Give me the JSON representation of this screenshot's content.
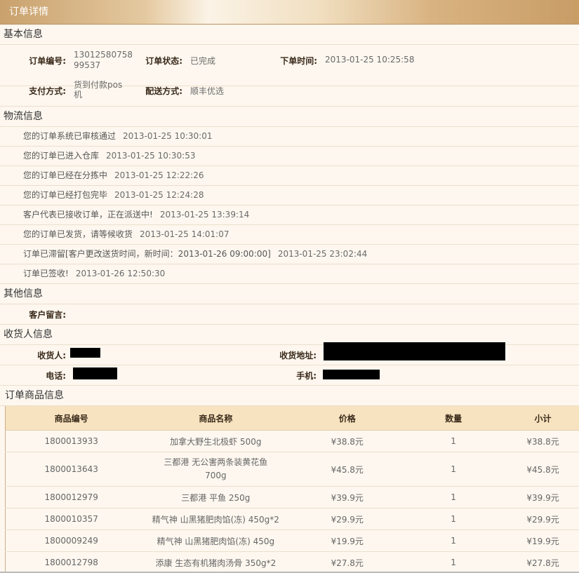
{
  "window": {
    "title": "订单详情"
  },
  "sections": {
    "basic": "基本信息",
    "logistics": "物流信息",
    "other": "其他信息",
    "receiver": "收货人信息",
    "goods": "订单商品信息"
  },
  "basic": {
    "order_no_label": "订单编号:",
    "order_no_line1": "13012580758",
    "order_no_line2": "99537",
    "status_label": "订单状态:",
    "status_value": "已完成",
    "time_label": "下单时间:",
    "time_value": "2013-01-25 10:25:58",
    "pay_label": "支付方式:",
    "pay_line1": "货到付款pos",
    "pay_line2": "机",
    "ship_label": "配送方式:",
    "ship_value": "顺丰优选"
  },
  "logistics": [
    {
      "text": "您的订单系统已审核通过",
      "time": "2013-01-25 10:30:01"
    },
    {
      "text": "您的订单已进入仓库",
      "time": "2013-01-25 10:30:53"
    },
    {
      "text": "您的订单已经在分拣中",
      "time": "2013-01-25 12:22:26"
    },
    {
      "text": "您的订单已经打包完毕",
      "time": "2013-01-25 12:24:28"
    },
    {
      "text": "客户代表已接收订单，正在派送中!",
      "time": "2013-01-25 13:39:14"
    },
    {
      "text": "您的订单已发货，请等候收货",
      "time": "2013-01-25 14:01:07"
    },
    {
      "text": "订单已滞留[客户更改送货时间，新时间：2013-01-26 09:00:00]",
      "time": "2013-01-25 23:02:44"
    },
    {
      "text": "订单已签收!",
      "time": "2013-01-26 12:50:30"
    }
  ],
  "other": {
    "message_label": "客户留言:"
  },
  "receiver": {
    "name_label": "收货人:",
    "address_label": "收货地址:",
    "phone_label": "电话:",
    "mobile_label": "手机:"
  },
  "goods_table": {
    "headers": [
      "商品编号",
      "商品名称",
      "价格",
      "数量",
      "小计"
    ],
    "rows": [
      {
        "id": "1800013933",
        "name": "加拿大野生北极虾 500g",
        "price": "¥38.8元",
        "qty": "1",
        "subtotal": "¥38.8元"
      },
      {
        "id": "1800013643",
        "name": "三都港 无公害两条装黄花鱼 700g",
        "price": "¥45.8元",
        "qty": "1",
        "subtotal": "¥45.8元"
      },
      {
        "id": "1800012979",
        "name": "三都港 平鱼 250g",
        "price": "¥39.9元",
        "qty": "1",
        "subtotal": "¥39.9元"
      },
      {
        "id": "1800010357",
        "name": "精气神 山黑猪肥肉馅(冻) 450g*2",
        "price": "¥29.9元",
        "qty": "1",
        "subtotal": "¥29.9元"
      },
      {
        "id": "1800009249",
        "name": "精气神 山黑猪肥肉馅(冻) 450g",
        "price": "¥19.9元",
        "qty": "1",
        "subtotal": "¥19.9元"
      },
      {
        "id": "1800012798",
        "name": "添康 生态有机猪肉汤骨 350g*2",
        "price": "¥27.8元",
        "qty": "1",
        "subtotal": "¥27.8元"
      }
    ]
  },
  "colors": {
    "header_gradient": "#c9a16c",
    "table_header": "#f7e3c0",
    "page_bg": "#fdf7ef"
  }
}
